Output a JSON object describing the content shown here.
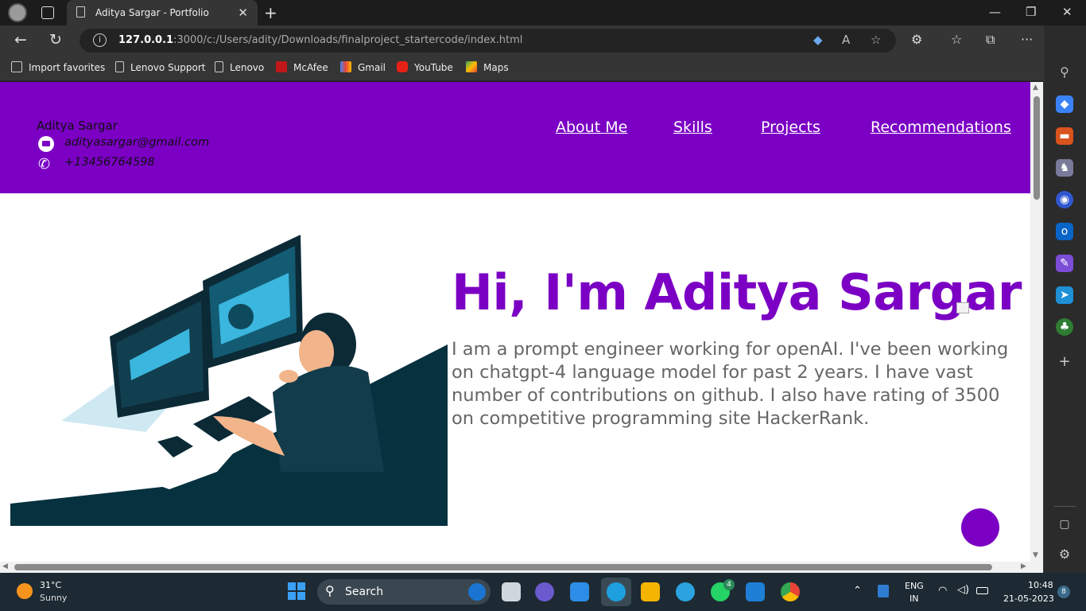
{
  "browser": {
    "tab_title": "Aditya Sargar - Portfolio",
    "url_host": "127.0.0.1",
    "url_rest": ":3000/c:/Users/adity/Downloads/finalproject_startercode/index.html",
    "favorites": [
      "Import favorites",
      "Lenovo Support",
      "Lenovo",
      "McAfee",
      "Gmail",
      "YouTube",
      "Maps"
    ]
  },
  "page": {
    "header": {
      "name": "Aditya Sargar",
      "email": "adityasargar@gmail.com",
      "phone": "+13456764598",
      "nav": [
        "About Me",
        "Skills",
        "Projects",
        "Recommendations"
      ]
    },
    "hero": {
      "title": "Hi, I'm Aditya Sargar",
      "text": "I am a prompt engineer working for openAI. I've been working on chatgpt-4 language model for past 2 years. I have vast number of contributions on github. I also have rating of 3500 on competitive programming site HackerRank."
    },
    "colors": {
      "accent": "#7b00c4",
      "hero_text": "#666666"
    }
  },
  "taskbar": {
    "weather_temp": "31°C",
    "weather_desc": "Sunny",
    "search_label": "Search",
    "whatsapp_badge": "4",
    "lang": "ENG",
    "region": "IN",
    "time": "10:48",
    "date": "21-05-2023",
    "notifications": "8"
  }
}
